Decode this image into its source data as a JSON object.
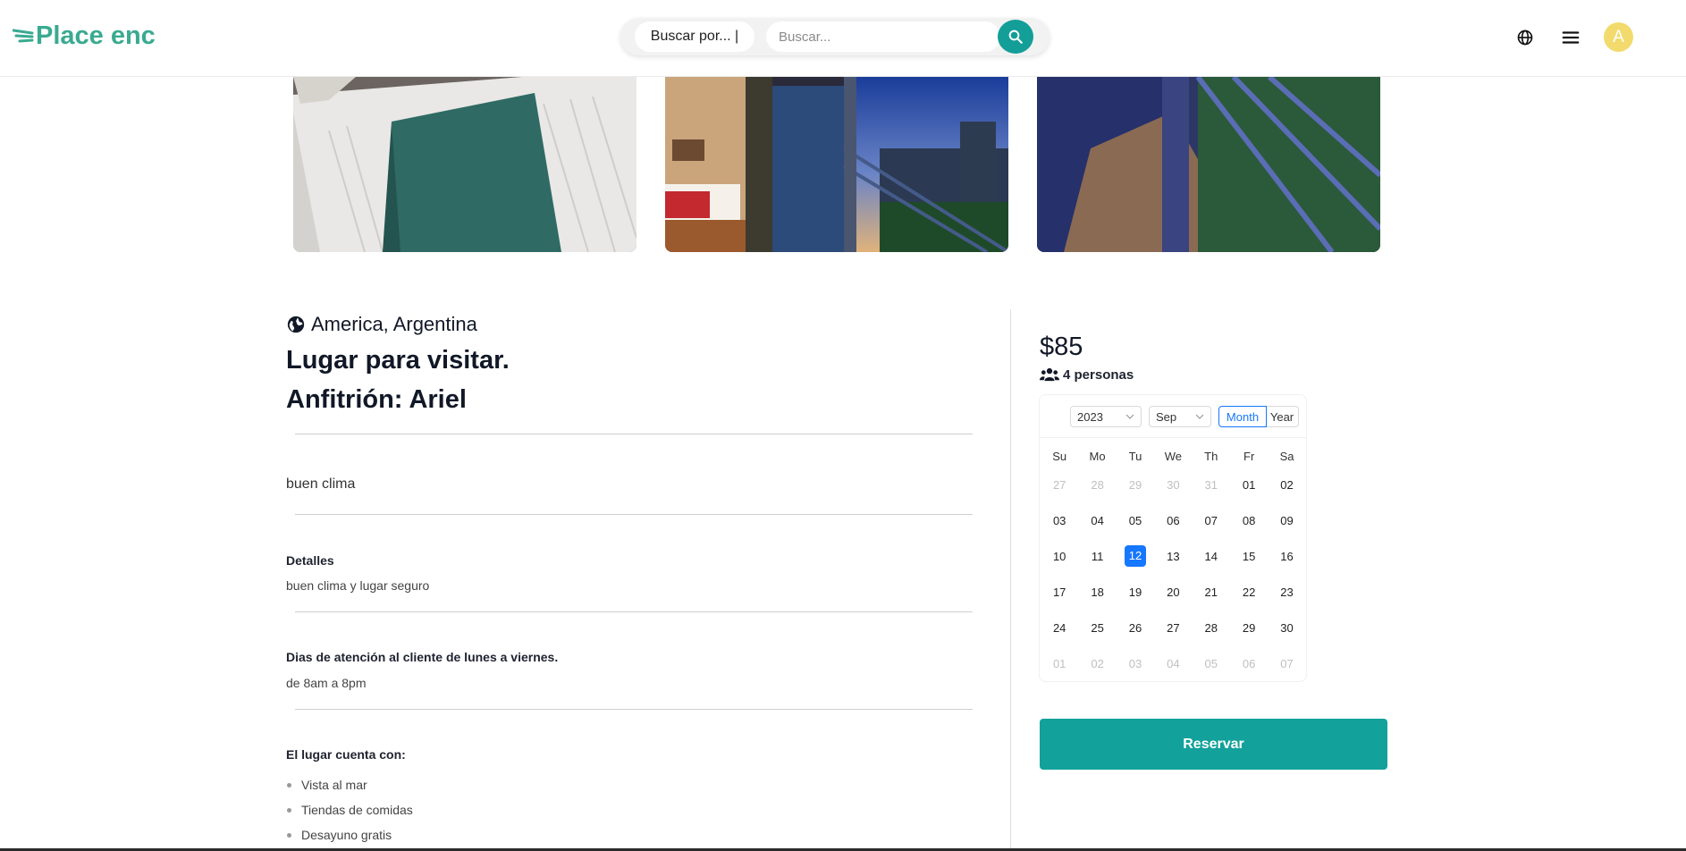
{
  "header": {
    "logo_text": "Place enc",
    "search_by_label": "Buscar por... |",
    "search_placeholder": "Buscar...",
    "avatar_letter": "A"
  },
  "icons": {
    "logo": "wind-lines-icon",
    "search": "search-icon",
    "language": "globe-icon",
    "menu": "hamburger-menu-icon",
    "location": "globe-filled-icon",
    "people": "users-icon"
  },
  "gallery": [
    {
      "name": "bed-with-runner"
    },
    {
      "name": "room-with-balcony-city-view"
    },
    {
      "name": "balcony-closeup"
    }
  ],
  "listing": {
    "location": "America, Argentina",
    "title": "Lugar para visitar.",
    "host": "Anfitrión: Ariel",
    "description": "buen clima",
    "details_title": "Detalles",
    "details_text": "buen clima y lugar seguro",
    "hours_title": "Dias de atención al cliente de lunes a viernes.",
    "hours_text": "de 8am a 8pm",
    "amenities_title": "El lugar cuenta con:",
    "amenities": [
      "Vista al mar",
      "Tiendas de comidas",
      "Desayuno gratis"
    ]
  },
  "booking": {
    "price": "$85",
    "people": "4 personas",
    "reserve_label": "Reservar"
  },
  "calendar": {
    "year": "2023",
    "month": "Sep",
    "mode_month": "Month",
    "mode_year": "Year",
    "weekdays": [
      "Su",
      "Mo",
      "Tu",
      "We",
      "Th",
      "Fr",
      "Sa"
    ],
    "weeks": [
      [
        {
          "d": "27",
          "m": true
        },
        {
          "d": "28",
          "m": true
        },
        {
          "d": "29",
          "m": true
        },
        {
          "d": "30",
          "m": true
        },
        {
          "d": "31",
          "m": true
        },
        {
          "d": "01"
        },
        {
          "d": "02"
        }
      ],
      [
        {
          "d": "03"
        },
        {
          "d": "04"
        },
        {
          "d": "05"
        },
        {
          "d": "06"
        },
        {
          "d": "07"
        },
        {
          "d": "08"
        },
        {
          "d": "09"
        }
      ],
      [
        {
          "d": "10"
        },
        {
          "d": "11"
        },
        {
          "d": "12",
          "today": true
        },
        {
          "d": "13"
        },
        {
          "d": "14"
        },
        {
          "d": "15"
        },
        {
          "d": "16"
        }
      ],
      [
        {
          "d": "17"
        },
        {
          "d": "18"
        },
        {
          "d": "19"
        },
        {
          "d": "20"
        },
        {
          "d": "21"
        },
        {
          "d": "22"
        },
        {
          "d": "23"
        }
      ],
      [
        {
          "d": "24"
        },
        {
          "d": "25"
        },
        {
          "d": "26"
        },
        {
          "d": "27"
        },
        {
          "d": "28"
        },
        {
          "d": "29"
        },
        {
          "d": "30"
        }
      ],
      [
        {
          "d": "01",
          "m": true
        },
        {
          "d": "02",
          "m": true
        },
        {
          "d": "03",
          "m": true
        },
        {
          "d": "04",
          "m": true
        },
        {
          "d": "05",
          "m": true
        },
        {
          "d": "06",
          "m": true
        },
        {
          "d": "07",
          "m": true
        }
      ]
    ]
  },
  "colors": {
    "brand": "#3aaa91",
    "accent_teal": "#13a19b",
    "selected_blue": "#1677ff",
    "avatar_bg": "#f2db6c"
  }
}
